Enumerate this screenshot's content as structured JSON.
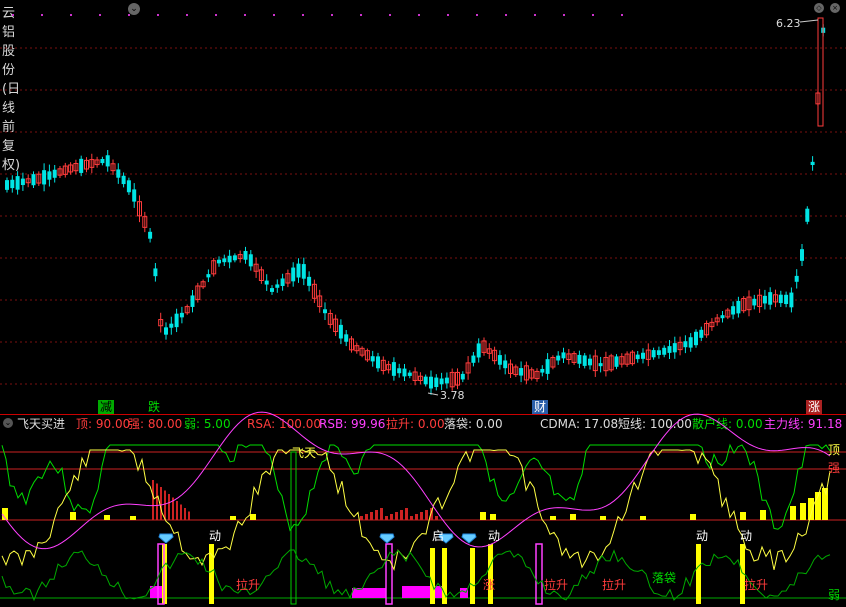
{
  "window": {
    "title": "云铝股份(日线 前复权)",
    "colors": {
      "up": "#ff3c3c",
      "down": "#00e5e5",
      "grid": "#7a1010",
      "bg": "#000000"
    }
  },
  "main_chart": {
    "high_label": "6.23",
    "low_label": "3.78",
    "event_tags": [
      {
        "label": "减",
        "color": "#00cc00"
      },
      {
        "label": "跌",
        "color": "#00cc00"
      },
      {
        "label": "财",
        "color": "#4aa8ff"
      },
      {
        "label": "涨",
        "color": "#ff5050"
      }
    ]
  },
  "indicator": {
    "name": "飞天买进",
    "params": [
      {
        "label": "顶: 90.00",
        "color": "#ff3c3c"
      },
      {
        "label": "强: 80.00",
        "color": "#ff3c3c"
      },
      {
        "label": "弱: 5.00",
        "color": "#00dd00"
      },
      {
        "label": "RSA: 100.00",
        "color": "#ff3c3c"
      },
      {
        "label": "RSB: 99.96",
        "color": "#ff40ff"
      },
      {
        "label": "拉升: 0.00",
        "color": "#ff3c3c"
      },
      {
        "label": "落袋: 0.00",
        "color": "#dddddd"
      },
      {
        "label": "CDMA: 17.08",
        "color": "#dddddd"
      },
      {
        "label": "短线: 100.00",
        "color": "#dddddd"
      },
      {
        "label": "散户线: 0.00",
        "color": "#00dd00"
      },
      {
        "label": "主力线: 91.18",
        "color": "#ff40ff"
      }
    ],
    "chart_labels": {
      "feitian": "飞天",
      "top": "顶",
      "strong": "强",
      "weak": "弱",
      "dong": "动",
      "lasheng": "拉升",
      "luodai": "落袋",
      "qi": "启",
      "zhang": "涨"
    }
  }
}
